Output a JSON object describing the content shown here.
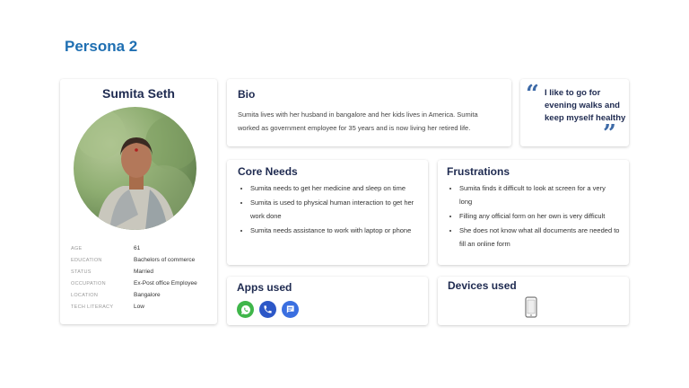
{
  "page": {
    "title": "Persona 2"
  },
  "profile": {
    "name": "Sumita Seth",
    "details": [
      {
        "label": "AGE",
        "value": "61"
      },
      {
        "label": "EDUCATION",
        "value": "Bachelors of commerce"
      },
      {
        "label": "STATUS",
        "value": "Married"
      },
      {
        "label": "OCCUPATION",
        "value": "Ex-Post office Employee"
      },
      {
        "label": "LOCATION",
        "value": "Bangalore"
      },
      {
        "label": "TECH LITERACY",
        "value": "Low"
      }
    ]
  },
  "bio": {
    "heading": "Bio",
    "text": "Sumita lives with her husband in bangalore and her kids lives in America. Sumita worked as government employee for 35 years and is now living her retired life."
  },
  "quote": {
    "text": "I like to go for evening walks and keep myself healthy"
  },
  "core_needs": {
    "heading": "Core Needs",
    "items": [
      "Sumita needs to get her medicine and sleep on time",
      "Sumita is used to physical human interaction to get her work done",
      "Sumita needs assistance to work with laptop or phone"
    ]
  },
  "frustrations": {
    "heading": "Frustrations",
    "items": [
      "Sumita finds it difficult to look at screen for a very long",
      "Filling any official form on her own is very difficult",
      "She does not know what all documents are needed to fill an online form"
    ]
  },
  "apps": {
    "heading": "Apps used",
    "icons": [
      "whatsapp-icon",
      "phone-call-icon",
      "messages-icon"
    ],
    "colors": {
      "whatsapp": "#3fb64a",
      "phone": "#2c57c7",
      "messages": "#3a6fe0"
    }
  },
  "devices": {
    "heading": "Devices used",
    "icons": [
      "smartphone-icon"
    ]
  }
}
